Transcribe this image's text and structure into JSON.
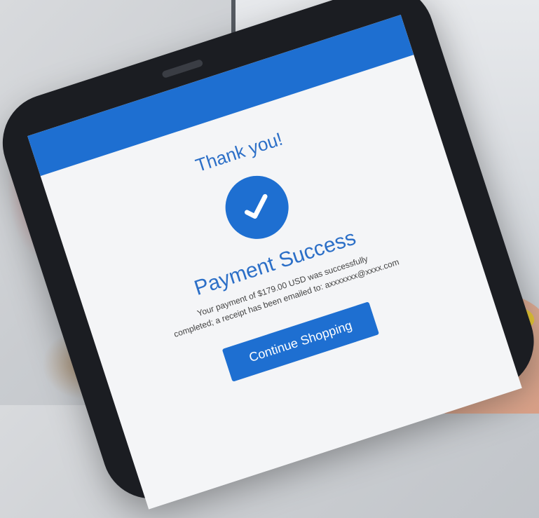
{
  "screen": {
    "title": "Thank you!",
    "headline": "Payment Success",
    "message_line1": "Your payment of $179.00 USD was successfully",
    "message_line2": "completed; a receipt has been emailed to: axxxxxxx@xxxx.com",
    "cta_label": "Continue Shopping"
  },
  "colors": {
    "accent": "#1e6fd1",
    "title_text": "#2c6fc7",
    "screen_bg": "#f4f5f7"
  },
  "icons": {
    "success": "check-circle-icon"
  }
}
